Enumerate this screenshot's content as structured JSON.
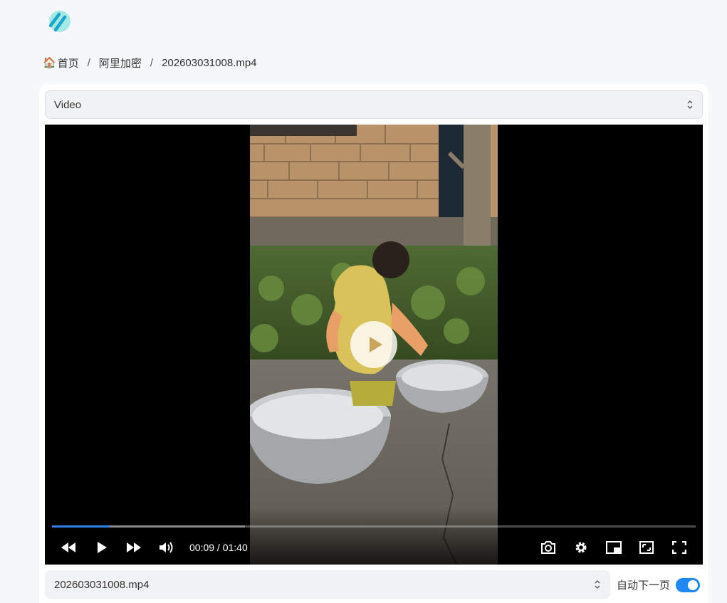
{
  "breadcrumb": {
    "home_label": "首页",
    "folder": "阿里加密",
    "file": "202603031008.mp4",
    "separator": "/"
  },
  "type_select": {
    "value": "Video"
  },
  "player": {
    "current_time": "00:09",
    "duration": "01:40",
    "time_text": "00:09 / 01:40",
    "played_fraction": 0.09,
    "buffered_fraction": 0.3,
    "accent": "#2f80ed",
    "icons": [
      "rewind-icon",
      "play-icon",
      "fast-forward-icon",
      "volume-icon",
      "screenshot-camera-icon",
      "settings-gear-icon",
      "picture-in-picture-icon",
      "web-fullscreen-icon",
      "fullscreen-icon"
    ]
  },
  "file_select": {
    "value": "202603031008.mp4"
  },
  "autonext": {
    "label": "自动下一页",
    "enabled": true,
    "color": "#1e88f5"
  }
}
